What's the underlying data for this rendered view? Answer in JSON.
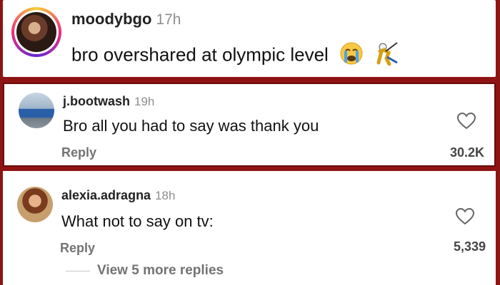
{
  "comments": [
    {
      "username": "moodybgo",
      "time": "17h",
      "text": "bro overshared at olympic level",
      "emoji": [
        "crying-face",
        "fencing-figure"
      ]
    },
    {
      "username": "j.bootwash",
      "time": "19h",
      "text": "Bro all you had to say was thank you",
      "reply_label": "Reply",
      "likes": "30.2K"
    },
    {
      "username": "alexia.adragna",
      "time": "18h",
      "text": "What not to say on tv:",
      "reply_label": "Reply",
      "likes": "5,339",
      "more_replies": "View 5 more replies"
    }
  ],
  "colors": {
    "frame": "#8e1414",
    "secondary_text": "#737373",
    "time_text": "#8e8e8e"
  }
}
